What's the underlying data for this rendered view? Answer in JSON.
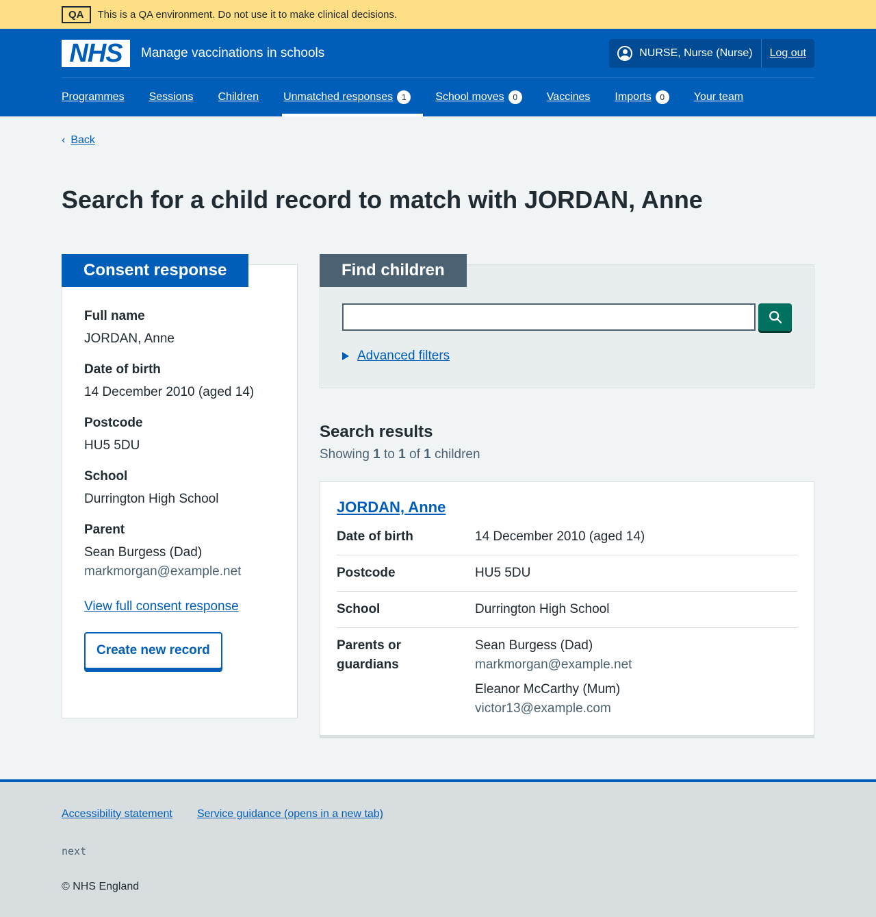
{
  "qa_banner": {
    "tag": "QA",
    "text": "This is a QA environment. Do not use it to make clinical decisions."
  },
  "header": {
    "logo_text": "NHS",
    "service_name": "Manage vaccinations in schools",
    "user": "NURSE, Nurse (Nurse)",
    "logout": "Log out",
    "nav": [
      {
        "label": "Programmes"
      },
      {
        "label": "Sessions"
      },
      {
        "label": "Children"
      },
      {
        "label": "Unmatched responses",
        "count": "1"
      },
      {
        "label": "School moves",
        "count": "0"
      },
      {
        "label": "Vaccines"
      },
      {
        "label": "Imports",
        "count": "0"
      },
      {
        "label": "Your team"
      }
    ]
  },
  "back_link": "Back",
  "page_title": "Search for a child record to match with JORDAN, Anne",
  "consent": {
    "heading": "Consent response",
    "full_name_label": "Full name",
    "full_name": "JORDAN, Anne",
    "dob_label": "Date of birth",
    "dob": "14 December 2010 (aged 14)",
    "postcode_label": "Postcode",
    "postcode": "HU5 5DU",
    "school_label": "School",
    "school": "Durrington High School",
    "parent_label": "Parent",
    "parent_name": "Sean Burgess (Dad)",
    "parent_email": "markmorgan@example.net",
    "view_link": "View full consent response",
    "create_button": "Create new record"
  },
  "find": {
    "heading": "Find children",
    "search_value": "",
    "advanced_filters": "Advanced filters"
  },
  "results": {
    "heading": "Search results",
    "showing_prefix": "Showing",
    "from": "1",
    "to_word": "to",
    "to": "1",
    "of_word": "of",
    "total": "1",
    "suffix": "children",
    "items": [
      {
        "name": "JORDAN, Anne",
        "dob_label": "Date of birth",
        "dob": "14 December 2010 (aged 14)",
        "postcode_label": "Postcode",
        "postcode": "HU5 5DU",
        "school_label": "School",
        "school": "Durrington High School",
        "parents_label": "Parents or guardians",
        "parents": [
          {
            "name": "Sean Burgess (Dad)",
            "email": "markmorgan@example.net"
          },
          {
            "name": "Eleanor McCarthy (Mum)",
            "email": "victor13@example.com"
          }
        ]
      }
    ]
  },
  "footer": {
    "links": [
      "Accessibility statement",
      "Service guidance (opens in a new tab)"
    ],
    "version": "next",
    "copyright": "© NHS England"
  },
  "colors": {
    "nhs_blue": "#005eb8",
    "qa_yellow": "#ffdf85",
    "search_green": "#00705f",
    "grey_heading": "#4c6272"
  }
}
